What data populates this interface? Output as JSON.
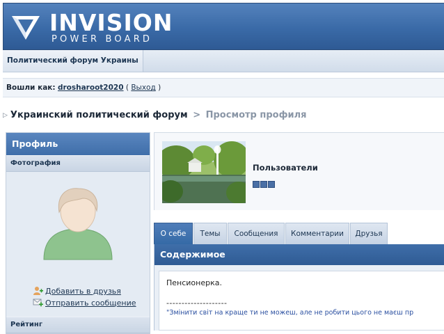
{
  "header": {
    "logo_title": "INVISION",
    "logo_subtitle": "POWER BOARD"
  },
  "nav": {
    "tab_forum": "Политический форум Украины"
  },
  "userbar": {
    "logged_in_as": "Вошли как:",
    "username": "drosharoot2020",
    "open_paren": "(",
    "logout": "Выход",
    "close_paren": ")"
  },
  "breadcrumb": {
    "arrow": "▷",
    "forum": "Украинский политический форум",
    "separator": ">",
    "current": "Просмотр профиля"
  },
  "sidebar": {
    "title": "Профиль",
    "photo_label": "Фотография",
    "add_friend": "Добавить в друзья",
    "send_message": "Отправить сообщение",
    "rating_label": "Рейтинг"
  },
  "profile": {
    "group": "Пользователи",
    "pips": 3
  },
  "tabs": [
    {
      "label": "О себе",
      "active": true
    },
    {
      "label": "Темы",
      "active": false
    },
    {
      "label": "Сообщения",
      "active": false
    },
    {
      "label": "Комментарии",
      "active": false
    },
    {
      "label": "Друзья",
      "active": false
    }
  ],
  "content": {
    "title": "Содержимое",
    "about": "Пенсионерка.",
    "separator": "--------------------",
    "quote": "\"Змінити світ на краще ти не можеш, але не робити цього не маєш пр"
  },
  "colors": {
    "header_blue": "#3a6aa7",
    "tab_active": "#356aa6",
    "link": "#1d3652"
  }
}
